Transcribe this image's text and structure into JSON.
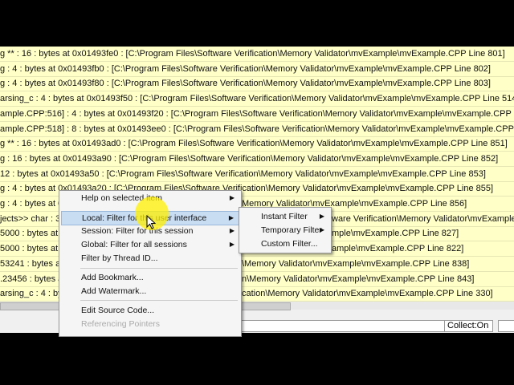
{
  "rows": [
    {
      "l": "g ** : 16 : bytes at 0x01493fe0 : [C:\\Program Files\\Software Verification\\Memory Validator\\mvExample\\mvExample.CPP Line 801]",
      "r": ""
    },
    {
      "l": "g : 4 : bytes at 0x01493fb0 : [C:\\Program Files\\Software Verification\\Memory Validator\\mvExample\\mvExample.CPP Line 802]",
      "r": ""
    },
    {
      "l": "g : 4 : bytes at 0x01493f80 : [C:\\Program Files\\Software Verification\\Memory Validator\\mvExample\\mvExample.CPP Line 803]",
      "r": ""
    },
    {
      "l": "arsing_c : 4 : bytes at 0x01493f50 : [C:\\Program Files\\Software Verification\\Memory Validator\\mvExample\\mvExample.CPP Line 514]",
      "r": ""
    },
    {
      "l": "ample.CPP:516] : 4 : bytes at 0x01493f20 : [C:\\Program Files\\Software Verification\\Memory Validator\\mvExample\\mvExample.CPP Line 516]",
      "r": ""
    },
    {
      "l": "ample.CPP:518] : 8 : bytes at 0x01493ee0 : [C:\\Program Files\\Software Verification\\Memory Validator\\mvExample\\mvExample.CPP Line 518]",
      "r": ""
    },
    {
      "l": "g ** : 16 : bytes at 0x01493ad0 : [C:\\Program Files\\Software Verification\\Memory Validator\\mvExample\\mvExample.CPP Line 851]",
      "r": ""
    },
    {
      "l": "g : 16 : bytes at 0x01493a90 : [C:\\Program Files\\Software Verification\\Memory Validator\\mvExample\\mvExample.CPP Line 852]",
      "r": ""
    },
    {
      "l": "12 : bytes at 0x01493a50 : [C:\\Program Files\\Software Verification\\Memory Validator\\mvExample\\mvExample.CPP Line 853]",
      "r": ""
    },
    {
      "l": "g : 4 : bytes at 0x01493a20 : [C:\\Program Files\\Software Verification\\Memory Validator\\mvExample\\mvExample.CPP Line 855]",
      "r": ""
    },
    {
      "l": "g : 4 : bytes at 0x0",
      "r": "Memory Validator\\mvExample\\mvExample.CPP Line 856]"
    },
    {
      "l": "jects>> char : 3",
      "r": "ware Verification\\Memory Validator\\mvExample\\mvExample"
    },
    {
      "l": "5000 : bytes at 0x",
      "r": "mple\\mvExample.CPP Line 827]"
    },
    {
      "l": "5000 : bytes at 0x",
      "r": "ample\\mvExample.CPP Line 822]"
    },
    {
      "l": "53241 : bytes at 0",
      "r": "\\Memory Validator\\mvExample\\mvExample.CPP Line 838]"
    },
    {
      "l": ".23456 : bytes at",
      "r": "n\\Memory Validator\\mvExample\\mvExample.CPP Line 843]"
    },
    {
      "l": "arsing_c : 4 : byte",
      "r": "cation\\Memory Validator\\mvExample\\mvExample.CPP Line 330]"
    }
  ],
  "status": {
    "collect": "Collect:On"
  },
  "menu": {
    "items": [
      {
        "label": "Help on selected item",
        "submenu": true
      },
      {
        "label": "Local: Filter for this user interface",
        "submenu": true,
        "highlighted": true
      },
      {
        "label": "Session: Filter for this session",
        "submenu": true
      },
      {
        "label": "Global: Filter for all sessions",
        "submenu": true
      },
      {
        "label": "Filter by Thread ID..."
      },
      {
        "label": "Add Bookmark..."
      },
      {
        "label": "Add Watermark..."
      },
      {
        "label": "Edit Source Code..."
      },
      {
        "label": "Referencing Pointers",
        "disabled": true
      }
    ]
  },
  "submenu": {
    "items": [
      {
        "label": "Instant Filter",
        "submenu": true
      },
      {
        "label": "Temporary Filter",
        "submenu": true
      },
      {
        "label": "Custom Filter..."
      }
    ]
  },
  "arrow_glyph": "▶"
}
